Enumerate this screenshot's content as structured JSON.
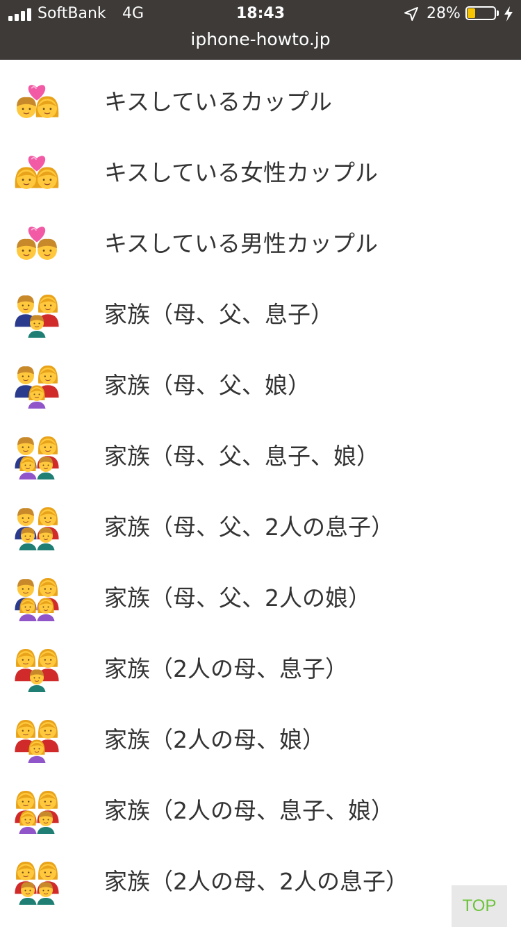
{
  "status_bar": {
    "carrier": "SoftBank",
    "network": "4G",
    "time": "18:43",
    "battery_percent": "28%",
    "battery_level": 0.28,
    "url": "iphone-howto.jp"
  },
  "items": [
    {
      "label": "キスしているカップル",
      "icon": "kiss-couple-icon",
      "type": "kiss",
      "people": [
        "man",
        "woman"
      ]
    },
    {
      "label": "キスしている女性カップル",
      "icon": "kiss-women-icon",
      "type": "kiss",
      "people": [
        "woman",
        "woman"
      ]
    },
    {
      "label": "キスしている男性カップル",
      "icon": "kiss-men-icon",
      "type": "kiss",
      "people": [
        "man",
        "man"
      ]
    },
    {
      "label": "家族（母、父、息子）",
      "icon": "family-man-woman-boy-icon",
      "type": "family",
      "parents": [
        "man",
        "woman"
      ],
      "kids": [
        "boy"
      ]
    },
    {
      "label": "家族（母、父、娘）",
      "icon": "family-man-woman-girl-icon",
      "type": "family",
      "parents": [
        "man",
        "woman"
      ],
      "kids": [
        "girl"
      ]
    },
    {
      "label": "家族（母、父、息子、娘）",
      "icon": "family-man-woman-girl-boy-icon",
      "type": "family",
      "parents": [
        "man",
        "woman"
      ],
      "kids": [
        "girl",
        "boy"
      ]
    },
    {
      "label": "家族（母、父、2人の息子）",
      "icon": "family-man-woman-boy-boy-icon",
      "type": "family",
      "parents": [
        "man",
        "woman"
      ],
      "kids": [
        "boy",
        "boy"
      ]
    },
    {
      "label": "家族（母、父、2人の娘）",
      "icon": "family-man-woman-girl-girl-icon",
      "type": "family",
      "parents": [
        "man",
        "woman"
      ],
      "kids": [
        "girl",
        "girl"
      ]
    },
    {
      "label": "家族（2人の母、息子）",
      "icon": "family-woman-woman-boy-icon",
      "type": "family",
      "parents": [
        "woman",
        "woman"
      ],
      "kids": [
        "boy"
      ]
    },
    {
      "label": "家族（2人の母、娘）",
      "icon": "family-woman-woman-girl-icon",
      "type": "family",
      "parents": [
        "woman",
        "woman"
      ],
      "kids": [
        "girl"
      ]
    },
    {
      "label": "家族（2人の母、息子、娘）",
      "icon": "family-woman-woman-girl-boy-icon",
      "type": "family",
      "parents": [
        "woman",
        "woman"
      ],
      "kids": [
        "girl",
        "boy"
      ]
    },
    {
      "label": "家族（2人の母、2人の息子）",
      "icon": "family-woman-woman-boy-boy-icon",
      "type": "family",
      "parents": [
        "woman",
        "woman"
      ],
      "kids": [
        "boy",
        "boy"
      ]
    }
  ],
  "top_button": {
    "label": "TOP"
  },
  "colors": {
    "status_bg": "#3d3a38",
    "text": "#333333",
    "skin": "#ffc83d",
    "hair_man": "#c8892a",
    "hair_woman": "#e8a31a",
    "heart": "#f25aa6",
    "shirt_man": "#2a3a8c",
    "shirt_woman": "#d02a2a",
    "kid_boy": "#1f7f74",
    "kid_girl": "#8f55c9",
    "top_green": "#6cc33a"
  }
}
